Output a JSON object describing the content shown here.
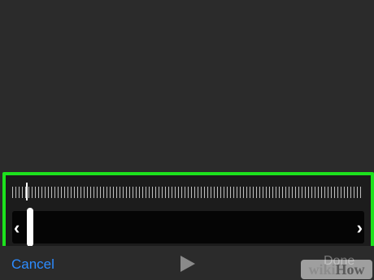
{
  "toolbar": {
    "cancel_label": "Cancel",
    "play_icon": "play-icon",
    "done_label": "Done"
  },
  "trimmer": {
    "left_handle_glyph": "‹",
    "right_handle_glyph": "›"
  },
  "watermark": {
    "wiki": "wiki",
    "how": "How"
  },
  "colors": {
    "highlight": "#1de21d",
    "accent": "#2d8cff",
    "background": "#2b2b2b"
  }
}
